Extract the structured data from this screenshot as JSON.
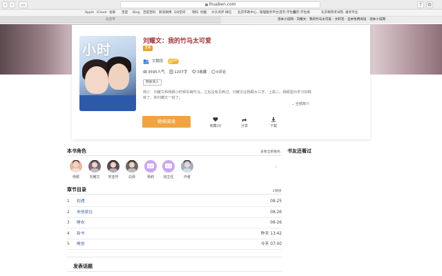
{
  "browser": {
    "url": "ihuaben.com",
    "bookmarks": [
      "Apple",
      "iCloud",
      "谷歌",
      "百度",
      "Bing",
      "百度百科",
      "新浪微博",
      "QQ空间",
      "瑞科",
      "优酷",
      "大众点评",
      "微信",
      "北京市政中心...管理服务平台",
      "首页-学生端",
      "首页-学生端",
      "北京教育考试院",
      "报考专业"
    ],
    "tabs": [
      "北京市",
      "话本小说网 - 刘耀文：我的竹马太可爱 - 文轩签 - 全本免费阅读 - 话本小说网"
    ]
  },
  "book": {
    "cover_text": "小时",
    "title": "刘耀文：我的竹马太可爱",
    "status": "连载",
    "author": "文翰忠",
    "vip": "VIP",
    "stats": {
      "popularity": "3595人气",
      "words": "1207字",
      "favorites": "3收藏",
      "comments": "0评论"
    },
    "tag": "明星同人",
    "description": "简介：刘耀文和杨颖小时候青梅竹马，之后没有见到过，刘耀文比杨颖大三岁，上高二，杨颖因为学习好跳级了，和刘耀文一班了。",
    "full_intro": "全部简介"
  },
  "actions": {
    "read": "继续阅读",
    "collect": "收藏(3)",
    "share": "分享",
    "download": "下载"
  },
  "roles": {
    "title": "本书角色",
    "link": "查看全部角色",
    "items": [
      {
        "name": "杨颖",
        "color": "#e8b7a4"
      },
      {
        "name": "刘耀文",
        "color": "#7d6a77"
      },
      {
        "name": "宋亚轩",
        "color": "#5b4a57"
      },
      {
        "name": "白倩",
        "color": "#6e6766"
      },
      {
        "name": "杨莉",
        "color": "#c9a8ef"
      },
      {
        "name": "班主任",
        "color": "#c9a8ef"
      },
      {
        "name": "作者",
        "color": "#9bb0c8"
      }
    ]
  },
  "also_read": {
    "title": "书友还看过"
  },
  "chapters": {
    "title": "章节目录",
    "sort": "倒序",
    "items": [
      {
        "no": "1",
        "name": "初遇",
        "date": "08-25"
      },
      {
        "no": "2",
        "name": "去他家住",
        "date": "08-26"
      },
      {
        "no": "3",
        "name": "睡衣",
        "date": "08-26"
      },
      {
        "no": "4",
        "name": "新书",
        "date": "昨天 13:42"
      },
      {
        "no": "5",
        "name": "睡觉",
        "date": "今天 07:00"
      }
    ]
  },
  "topics": {
    "title": "发表话题"
  }
}
